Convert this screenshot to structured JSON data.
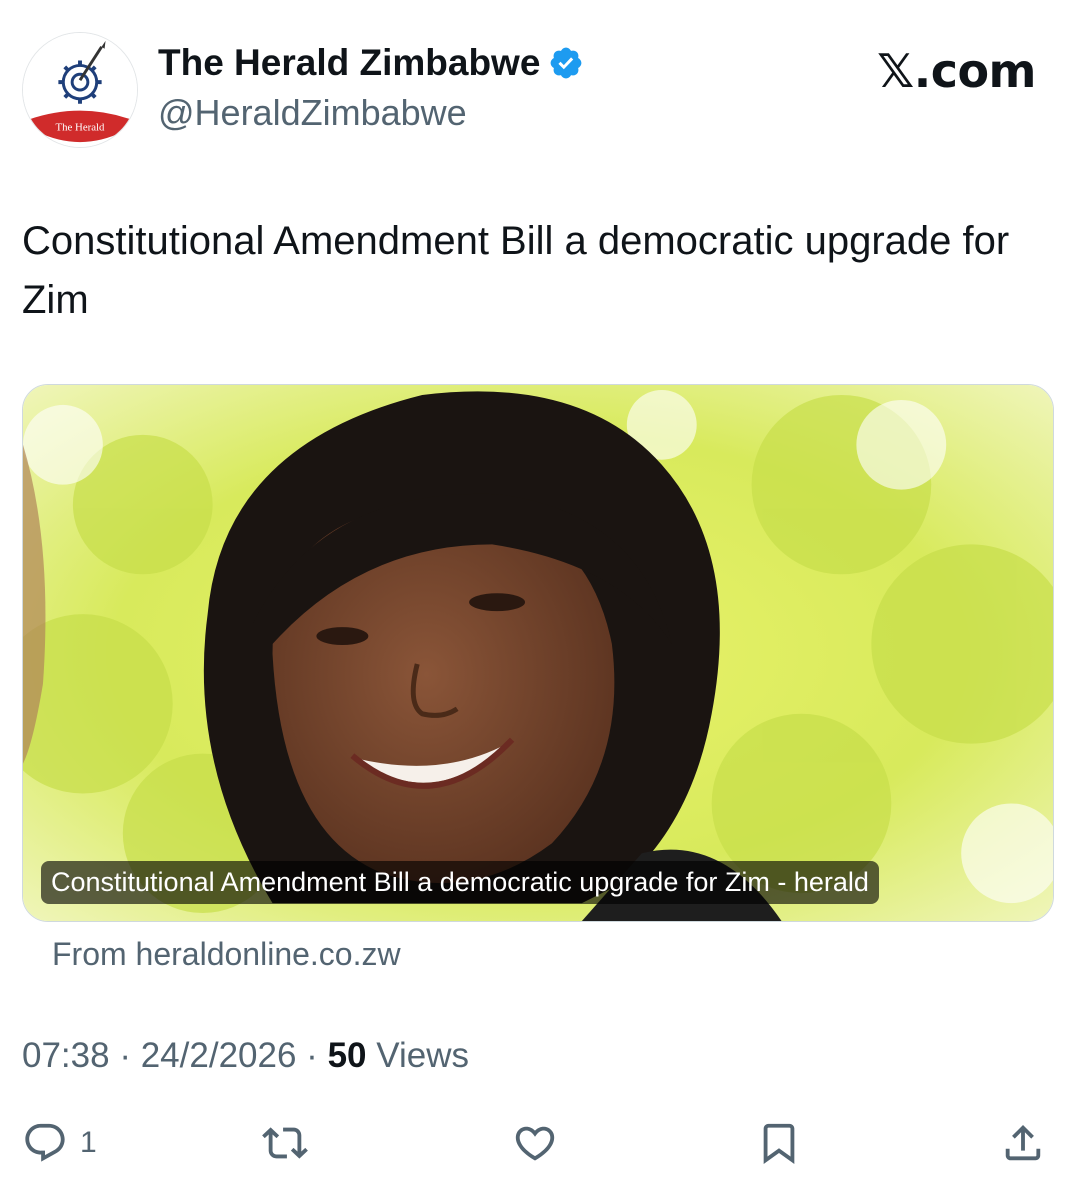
{
  "account": {
    "display_name": "The Herald Zimbabwe",
    "handle": "@HeraldZimbabwe",
    "avatar_text": "The Herald",
    "verified": true
  },
  "brand": "𝕏.com",
  "tweet": {
    "text": "Constitutional Amendment Bill a democratic upgrade for Zim"
  },
  "card": {
    "caption": "Constitutional Amendment Bill a democratic upgrade for Zim - herald",
    "source": "From heraldonline.co.zw"
  },
  "meta": {
    "time": "07:38",
    "date": "24/2/2026",
    "views_count": "50",
    "views_label": "Views"
  },
  "actions": {
    "reply_count": "1",
    "icons": [
      "reply-icon",
      "retweet-icon",
      "like-icon",
      "bookmark-icon",
      "share-icon"
    ]
  },
  "colors": {
    "verified": "#1d9bf0",
    "secondary_text": "#536471",
    "primary_text": "#0f1419",
    "logo_red": "#d02b2b"
  }
}
